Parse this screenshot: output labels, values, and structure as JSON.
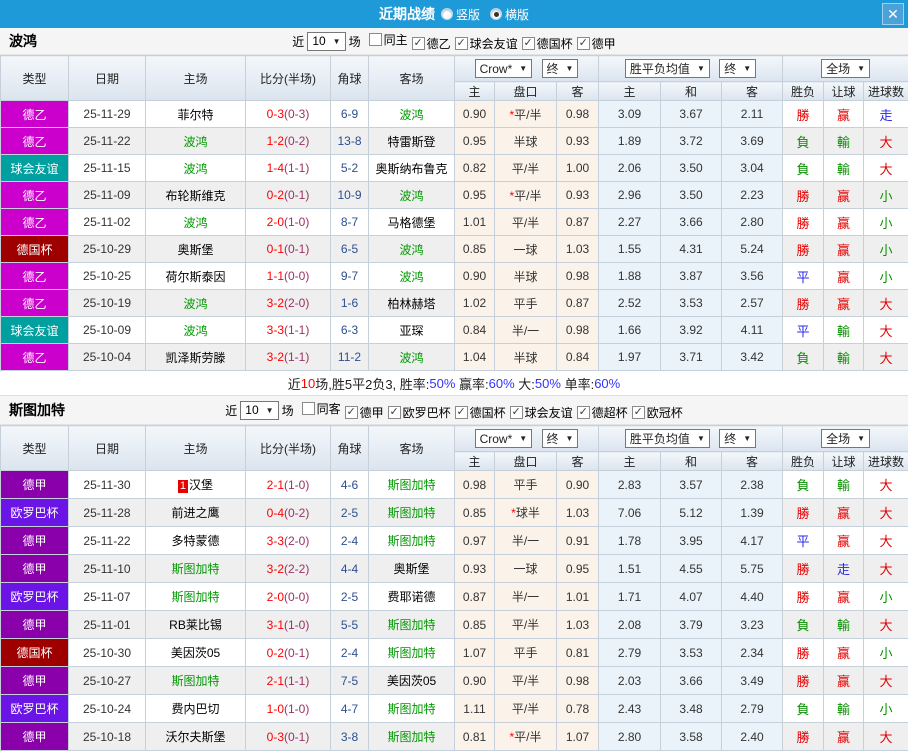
{
  "titlebar": {
    "title": "近期战绩",
    "radios": [
      {
        "label": "竖版",
        "checked": false
      },
      {
        "label": "横版",
        "checked": true
      }
    ],
    "close_icon": "✕"
  },
  "table_headers": {
    "cols": [
      "类型",
      "日期",
      "主场",
      "比分(半场)",
      "角球",
      "客场"
    ],
    "sub": [
      "主",
      "盘口",
      "客",
      "主",
      "和",
      "客",
      "胜负",
      "让球",
      "进球数"
    ],
    "bookmaker": "Crow*",
    "stage": "终",
    "avg": "胜平负均值",
    "stage2": "终",
    "full": "全场"
  },
  "comp_colors": {
    "德乙": "#cc00cc",
    "球会友谊": "#00a0a0",
    "德国杯": "#9e0000",
    "德甲": "#8a00aa",
    "欧罗巴杯": "#6a14e6"
  },
  "sections": [
    {
      "team": "波鸿",
      "controls": {
        "near_label": "近",
        "count": "10",
        "matches_label": "场",
        "same": {
          "label": "同主",
          "checked": false
        },
        "comps": [
          {
            "label": "德乙",
            "checked": true
          },
          {
            "label": "球会友谊",
            "checked": true
          },
          {
            "label": "德国杯",
            "checked": true
          },
          {
            "label": "德甲",
            "checked": true
          }
        ]
      },
      "rows": [
        {
          "comp": "德乙",
          "date": "25-11-29",
          "home": "菲尔特",
          "ft": "0-3",
          "ht": "(0-3)",
          "corners": "6-9",
          "away": "波鸿",
          "h": "0.90",
          "handicap": "*平/半",
          "a": "0.98",
          "avg_home": "3.09",
          "avg_draw": "3.67",
          "avg_away": "2.11",
          "wdl": "勝",
          "asian": "赢",
          "ou": "走"
        },
        {
          "comp": "德乙",
          "date": "25-11-22",
          "home": "波鸿",
          "ft": "1-2",
          "ht": "(0-2)",
          "corners": "13-8",
          "away": "特雷斯登",
          "h": "0.95",
          "handicap": "半球",
          "a": "0.93",
          "avg_home": "1.89",
          "avg_draw": "3.72",
          "avg_away": "3.69",
          "wdl": "負",
          "asian": "輸",
          "ou": "大"
        },
        {
          "comp": "球会友谊",
          "date": "25-11-15",
          "home": "波鸿",
          "ft": "1-4",
          "ht": "(1-1)",
          "corners": "5-2",
          "away": "奥斯纳布鲁克",
          "h": "0.82",
          "handicap": "平/半",
          "a": "1.00",
          "avg_home": "2.06",
          "avg_draw": "3.50",
          "avg_away": "3.04",
          "wdl": "負",
          "asian": "輸",
          "ou": "大"
        },
        {
          "comp": "德乙",
          "date": "25-11-09",
          "home": "布轮斯维克",
          "ft": "0-2",
          "ht": "(0-1)",
          "corners": "10-9",
          "away": "波鸿",
          "h": "0.95",
          "handicap": "*平/半",
          "a": "0.93",
          "avg_home": "2.96",
          "avg_draw": "3.50",
          "avg_away": "2.23",
          "wdl": "勝",
          "asian": "赢",
          "ou": "小"
        },
        {
          "comp": "德乙",
          "date": "25-11-02",
          "home": "波鸿",
          "ft": "2-0",
          "ht": "(1-0)",
          "corners": "8-7",
          "away": "马格德堡",
          "h": "1.01",
          "handicap": "平/半",
          "a": "0.87",
          "avg_home": "2.27",
          "avg_draw": "3.66",
          "avg_away": "2.80",
          "wdl": "勝",
          "asian": "赢",
          "ou": "小"
        },
        {
          "comp": "德国杯",
          "date": "25-10-29",
          "home": "奥斯堡",
          "ft": "0-1",
          "ht": "(0-1)",
          "corners": "6-5",
          "away": "波鸿",
          "h": "0.85",
          "handicap": "一球",
          "a": "1.03",
          "avg_home": "1.55",
          "avg_draw": "4.31",
          "avg_away": "5.24",
          "wdl": "勝",
          "asian": "赢",
          "ou": "小"
        },
        {
          "comp": "德乙",
          "date": "25-10-25",
          "home": "荷尔斯泰因",
          "ft": "1-1",
          "ht": "(0-0)",
          "corners": "9-7",
          "away": "波鸿",
          "h": "0.90",
          "handicap": "半球",
          "a": "0.98",
          "avg_home": "1.88",
          "avg_draw": "3.87",
          "avg_away": "3.56",
          "wdl": "平",
          "asian": "赢",
          "ou": "小"
        },
        {
          "comp": "德乙",
          "date": "25-10-19",
          "home": "波鸿",
          "ft": "3-2",
          "ht": "(2-0)",
          "corners": "1-6",
          "away": "柏林赫塔",
          "h": "1.02",
          "handicap": "平手",
          "a": "0.87",
          "avg_home": "2.52",
          "avg_draw": "3.53",
          "avg_away": "2.57",
          "wdl": "勝",
          "asian": "赢",
          "ou": "大"
        },
        {
          "comp": "球会友谊",
          "date": "25-10-09",
          "home": "波鸿",
          "ft": "3-3",
          "ht": "(1-1)",
          "corners": "6-3",
          "away": "亚琛",
          "h": "0.84",
          "handicap": "半/一",
          "a": "0.98",
          "avg_home": "1.66",
          "avg_draw": "3.92",
          "avg_away": "4.11",
          "wdl": "平",
          "asian": "輸",
          "ou": "大"
        },
        {
          "comp": "德乙",
          "date": "25-10-04",
          "home": "凯泽斯劳滕",
          "ft": "3-2",
          "ht": "(1-1)",
          "corners": "11-2",
          "away": "波鸿",
          "h": "1.04",
          "handicap": "半球",
          "a": "0.84",
          "avg_home": "1.97",
          "avg_draw": "3.71",
          "avg_away": "3.42",
          "wdl": "負",
          "asian": "輸",
          "ou": "大"
        }
      ],
      "summary_parts": [
        {
          "t": "近",
          "c": "k"
        },
        {
          "t": "10",
          "c": "r"
        },
        {
          "t": "场,胜5平2负3, 胜率:",
          "c": "k"
        },
        {
          "t": "50%",
          "c": "b"
        },
        {
          "t": " 赢率:",
          "c": "k"
        },
        {
          "t": "60%",
          "c": "b"
        },
        {
          "t": " 大:",
          "c": "k"
        },
        {
          "t": "50%",
          "c": "b"
        },
        {
          "t": " 单率:",
          "c": "k"
        },
        {
          "t": "60%",
          "c": "b"
        }
      ]
    },
    {
      "team": "斯图加特",
      "controls": {
        "near_label": "近",
        "count": "10",
        "matches_label": "场",
        "same": {
          "label": "同客",
          "checked": false
        },
        "comps": [
          {
            "label": "德甲",
            "checked": true
          },
          {
            "label": "欧罗巴杯",
            "checked": true
          },
          {
            "label": "德国杯",
            "checked": true
          },
          {
            "label": "球会友谊",
            "checked": true
          },
          {
            "label": "德超杯",
            "checked": true
          },
          {
            "label": "欧冠杯",
            "checked": true
          }
        ]
      },
      "rows": [
        {
          "comp": "德甲",
          "date": "25-11-30",
          "home": "汉堡",
          "home_rank": "1",
          "ft": "2-1",
          "ht": "(1-0)",
          "corners": "4-6",
          "away": "斯图加特",
          "h": "0.98",
          "handicap": "平手",
          "a": "0.90",
          "avg_home": "2.83",
          "avg_draw": "3.57",
          "avg_away": "2.38",
          "wdl": "負",
          "asian": "輸",
          "ou": "大"
        },
        {
          "comp": "欧罗巴杯",
          "date": "25-11-28",
          "home": "前进之鹰",
          "ft": "0-4",
          "ht": "(0-2)",
          "corners": "2-5",
          "away": "斯图加特",
          "h": "0.85",
          "handicap": "*球半",
          "a": "1.03",
          "avg_home": "7.06",
          "avg_draw": "5.12",
          "avg_away": "1.39",
          "wdl": "勝",
          "asian": "赢",
          "ou": "大"
        },
        {
          "comp": "德甲",
          "date": "25-11-22",
          "home": "多特蒙德",
          "ft": "3-3",
          "ht": "(2-0)",
          "corners": "2-4",
          "away": "斯图加特",
          "h": "0.97",
          "handicap": "半/一",
          "a": "0.91",
          "avg_home": "1.78",
          "avg_draw": "3.95",
          "avg_away": "4.17",
          "wdl": "平",
          "asian": "赢",
          "ou": "大"
        },
        {
          "comp": "德甲",
          "date": "25-11-10",
          "home": "斯图加特",
          "ft": "3-2",
          "ht": "(2-2)",
          "corners": "4-4",
          "away": "奥斯堡",
          "h": "0.93",
          "handicap": "一球",
          "a": "0.95",
          "avg_home": "1.51",
          "avg_draw": "4.55",
          "avg_away": "5.75",
          "wdl": "勝",
          "asian": "走",
          "ou": "大"
        },
        {
          "comp": "欧罗巴杯",
          "date": "25-11-07",
          "home": "斯图加特",
          "ft": "2-0",
          "ht": "(0-0)",
          "corners": "2-5",
          "away": "费耶诺德",
          "h": "0.87",
          "handicap": "半/一",
          "a": "1.01",
          "avg_home": "1.71",
          "avg_draw": "4.07",
          "avg_away": "4.40",
          "wdl": "勝",
          "asian": "赢",
          "ou": "小"
        },
        {
          "comp": "德甲",
          "date": "25-11-01",
          "home": "RB莱比锡",
          "ft": "3-1",
          "ht": "(1-0)",
          "corners": "5-5",
          "away": "斯图加特",
          "h": "0.85",
          "handicap": "平/半",
          "a": "1.03",
          "avg_home": "2.08",
          "avg_draw": "3.79",
          "avg_away": "3.23",
          "wdl": "負",
          "asian": "輸",
          "ou": "大"
        },
        {
          "comp": "德国杯",
          "date": "25-10-30",
          "home": "美因茨05",
          "ft": "0-2",
          "ht": "(0-1)",
          "corners": "2-4",
          "away": "斯图加特",
          "h": "1.07",
          "handicap": "平手",
          "a": "0.81",
          "avg_home": "2.79",
          "avg_draw": "3.53",
          "avg_away": "2.34",
          "wdl": "勝",
          "asian": "赢",
          "ou": "小"
        },
        {
          "comp": "德甲",
          "date": "25-10-27",
          "home": "斯图加特",
          "ft": "2-1",
          "ht": "(1-1)",
          "corners": "7-5",
          "away": "美因茨05",
          "h": "0.90",
          "handicap": "平/半",
          "a": "0.98",
          "avg_home": "2.03",
          "avg_draw": "3.66",
          "avg_away": "3.49",
          "wdl": "勝",
          "asian": "赢",
          "ou": "大"
        },
        {
          "comp": "欧罗巴杯",
          "date": "25-10-24",
          "home": "费内巴切",
          "ft": "1-0",
          "ht": "(1-0)",
          "corners": "4-7",
          "away": "斯图加特",
          "h": "1.11",
          "handicap": "平/半",
          "a": "0.78",
          "avg_home": "2.43",
          "avg_draw": "3.48",
          "avg_away": "2.79",
          "wdl": "負",
          "asian": "輸",
          "ou": "小"
        },
        {
          "comp": "德甲",
          "date": "25-10-18",
          "home": "沃尔夫斯堡",
          "ft": "0-3",
          "ht": "(0-1)",
          "corners": "3-8",
          "away": "斯图加特",
          "h": "0.81",
          "handicap": "*平/半",
          "a": "1.07",
          "avg_home": "2.80",
          "avg_draw": "3.58",
          "avg_away": "2.40",
          "wdl": "勝",
          "asian": "赢",
          "ou": "大"
        }
      ]
    }
  ]
}
